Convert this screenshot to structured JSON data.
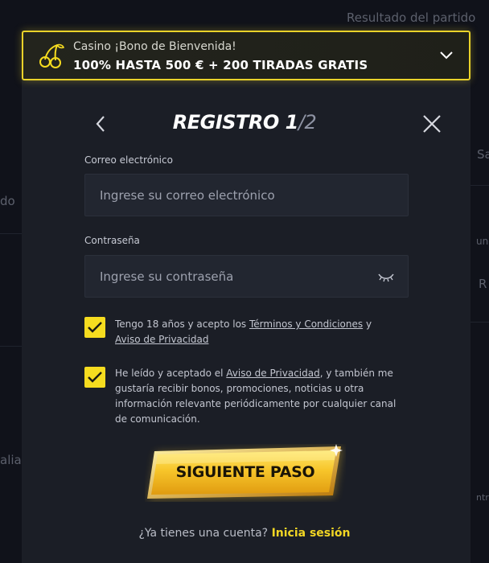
{
  "background": {
    "match_result": "Resultado del partido",
    "fragment_do": "do",
    "fragment_sa": "Sa",
    "fragment_und": "und",
    "fragment_r": "R",
    "fragment_alia": "alia",
    "fragment_ntra": "ntra"
  },
  "bonus": {
    "subtitle": "Casino ¡Bono de Bienvenida!",
    "headline": "100% HASTA 500 € + 200 TIRADAS GRATIS",
    "icon": "cherries-icon",
    "accent": "#e9d22a"
  },
  "header": {
    "title": "REGISTRO 1",
    "step_suffix": "/2"
  },
  "form": {
    "email_label": "Correo electrónico",
    "email_placeholder": "Ingrese su correo electrónico",
    "email_value": "",
    "password_label": "Contraseña",
    "password_placeholder": "Ingrese su contraseña",
    "password_value": ""
  },
  "consents": {
    "age": {
      "checked": true,
      "text_before": "Tengo 18 años y acepto los ",
      "link_terms": "Términos y Condiciones",
      "text_mid": " y ",
      "link_privacy": "Aviso de Privacidad"
    },
    "marketing": {
      "checked": true,
      "text_before": "He leído y aceptado el ",
      "link_privacy": "Aviso de Privacidad",
      "text_after": ", y también me gustaría recibir bonos, promociones, noticias u otra información relevante periódicamente por cualquier canal de comunicación."
    }
  },
  "actions": {
    "next_label": "SIGUIENTE PASO",
    "login_prompt": "¿Ya tienes una cuenta? ",
    "login_link": "Inicia sesión"
  },
  "colors": {
    "accent_yellow": "#f6dc1f",
    "modal_bg": "#1b1e26"
  }
}
